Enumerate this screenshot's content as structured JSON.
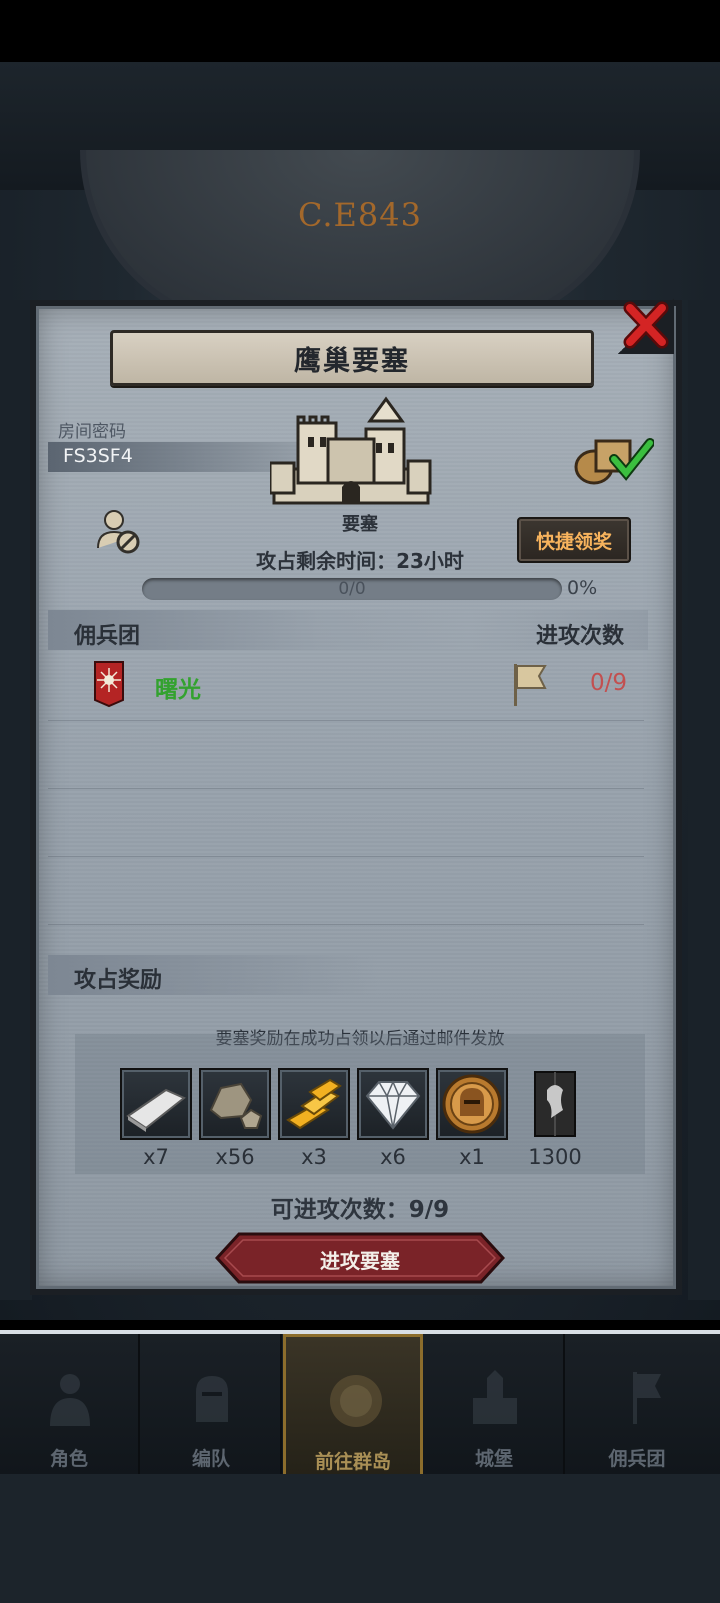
{
  "world": {
    "year_label": "C.E843"
  },
  "dialog": {
    "title": "鹰巢要塞",
    "room_label": "房间密码",
    "room_code": "FS3SF4",
    "fortress_label": "要塞",
    "remaining_time_label": "攻占剩余时间：",
    "remaining_time_value": "23小时",
    "quick_claim_label": "快捷领奖",
    "progress_text": "0/0",
    "progress_fraction": 0,
    "progress_percent": "0%",
    "mercs_header": "佣兵团",
    "attacks_header": "进攻次数",
    "mercs": [
      {
        "name": "曙光",
        "attacks": "0/9"
      }
    ],
    "rewards_header": "攻占奖励",
    "reward_note": "要塞奖励在成功占领以后通过邮件发放",
    "rewards": [
      {
        "icon": "silver-bar-icon",
        "qty": "x7"
      },
      {
        "icon": "stone-ore-icon",
        "qty": "x56"
      },
      {
        "icon": "gold-bars-icon",
        "qty": "x3"
      },
      {
        "icon": "diamond-icon",
        "qty": "x6"
      },
      {
        "icon": "knight-coin-icon",
        "qty": "x1"
      },
      {
        "icon": "honor-banner-icon",
        "qty": "1300"
      }
    ],
    "can_attack_text": "可进攻次数：9/9",
    "attack_button_label": "进攻要塞"
  },
  "nav": [
    {
      "label": "角色",
      "icon": "character-icon"
    },
    {
      "label": "编队",
      "icon": "formation-icon"
    },
    {
      "label": "前往群岛",
      "icon": "islands-icon"
    },
    {
      "label": "城堡",
      "icon": "castle-icon"
    },
    {
      "label": "佣兵团",
      "icon": "mercenary-icon"
    }
  ],
  "colors": {
    "accent_orange": "#f7b35d",
    "merc_green": "#33a22f",
    "attack_red": "#c25050",
    "button_red": "#7a2328"
  }
}
